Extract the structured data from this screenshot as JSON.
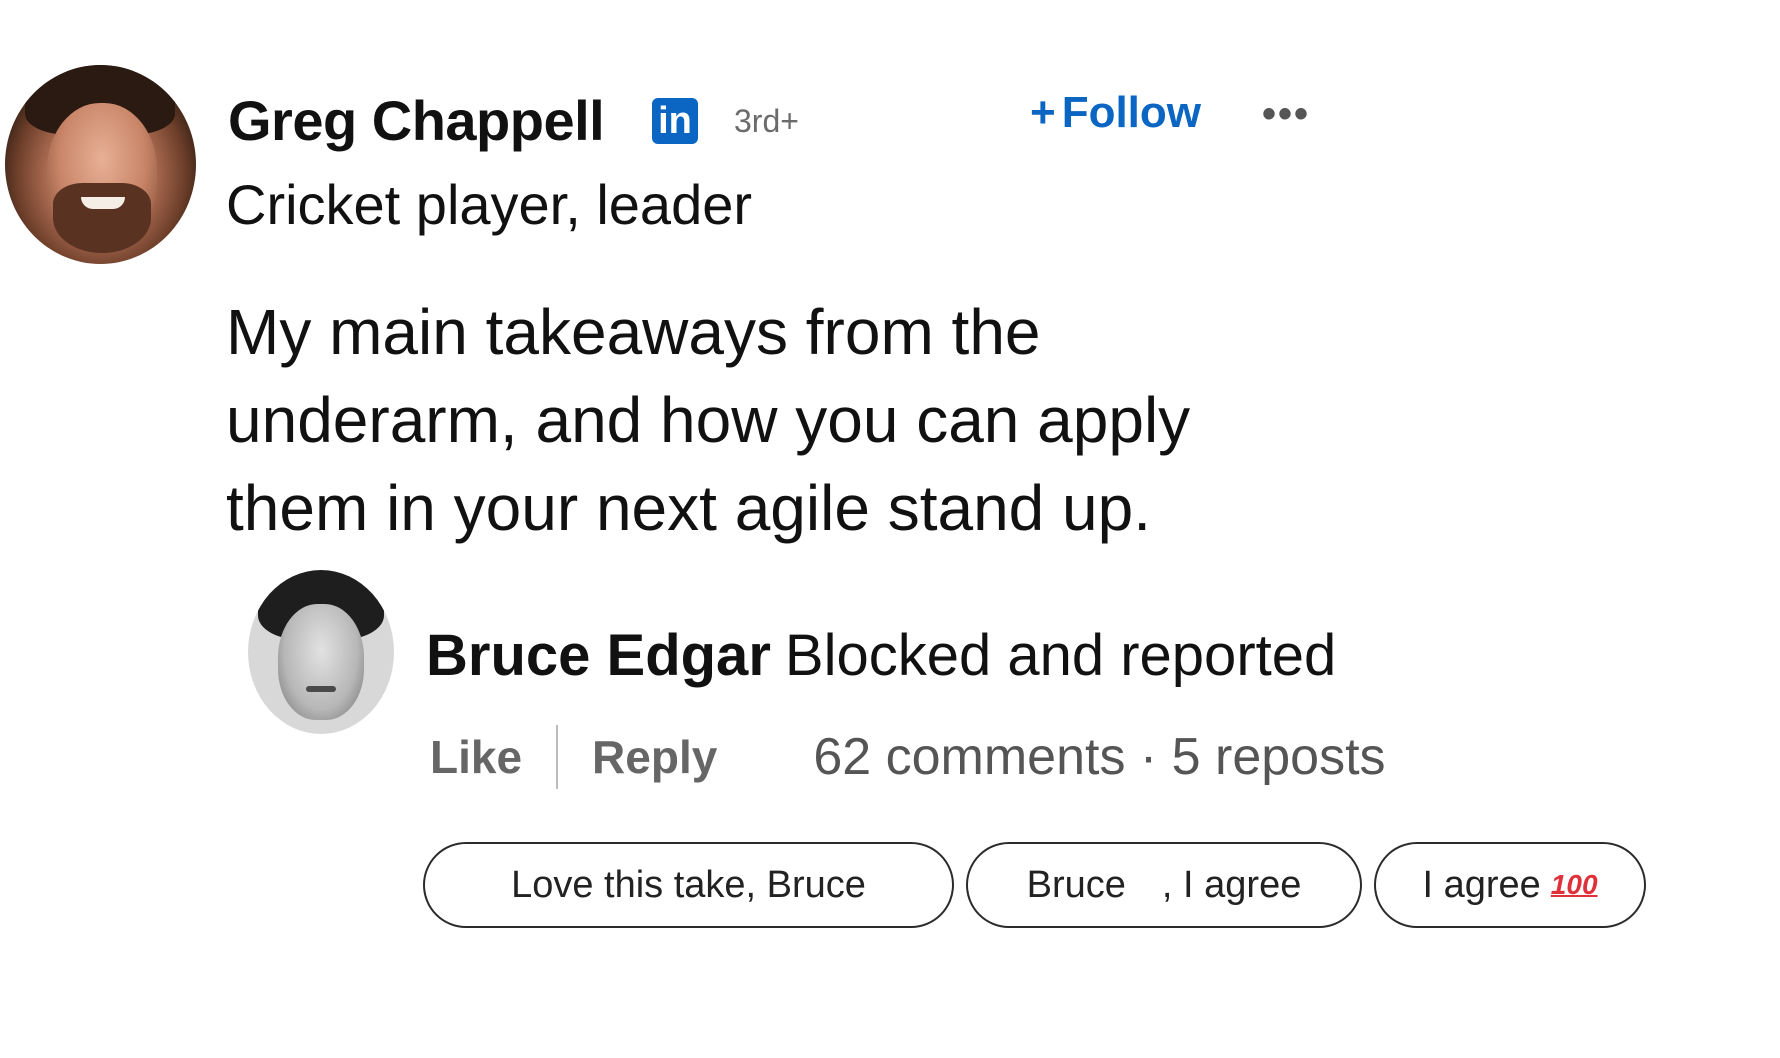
{
  "post": {
    "author": {
      "name": "Greg Chappell",
      "badge_text": "in",
      "degree": "3rd+",
      "headline": "Cricket player, leader",
      "avatar_icon": "profile-photo"
    },
    "follow_label": "Follow",
    "follow_plus": "+",
    "more_icon": "•••",
    "body": "My main takeaways from the underarm, and how you can apply them in your next agile stand up."
  },
  "comment": {
    "author": "Bruce Edgar",
    "text": "Blocked and reported",
    "avatar_icon": "profile-photo",
    "like_label": "Like",
    "reply_label": "Reply",
    "stats": "62 comments · 5 reposts"
  },
  "suggested_replies": {
    "pill_1": "Love this take, Bruce",
    "pill_2_a": "Bruce",
    "pill_2_b": ", I agree",
    "pill_3": "I agree",
    "pill_3_emoji": "100"
  },
  "colors": {
    "accent": "#0a66c2",
    "text": "#111111",
    "muted": "#666666",
    "hundred_emoji": "#e0303a"
  }
}
